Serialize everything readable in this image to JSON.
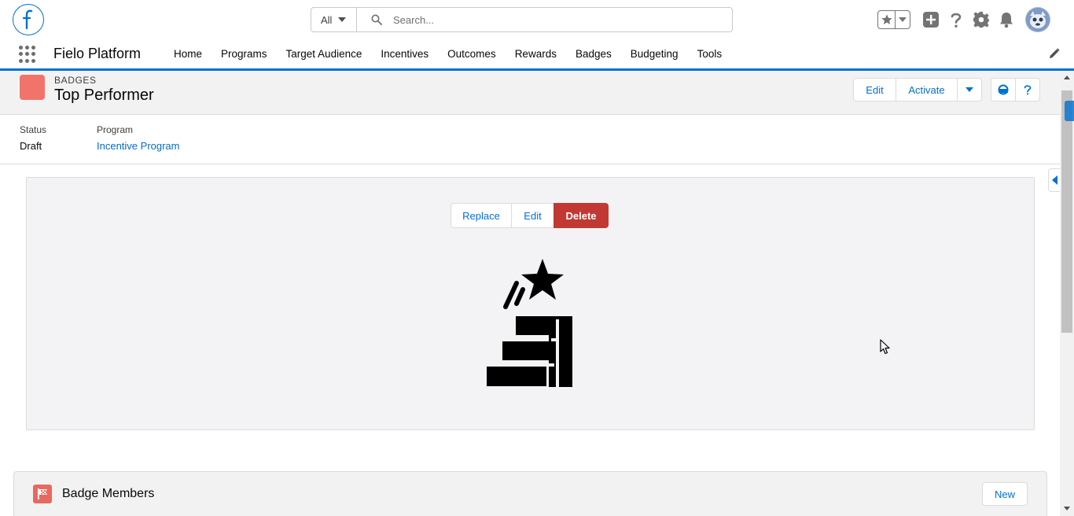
{
  "header": {
    "search_scope": "All",
    "search_placeholder": "Search..."
  },
  "app": {
    "name": "Fielo Platform",
    "nav_items": [
      "Home",
      "Programs",
      "Target Audience",
      "Incentives",
      "Outcomes",
      "Rewards",
      "Badges",
      "Budgeting",
      "Tools"
    ]
  },
  "record": {
    "type_label": "BADGES",
    "title": "Top Performer",
    "actions": {
      "edit": "Edit",
      "activate": "Activate"
    },
    "icon_color": "#f2736a"
  },
  "highlights": {
    "status_label": "Status",
    "status_value": "Draft",
    "program_label": "Program",
    "program_value": "Incentive Program"
  },
  "image_panel": {
    "replace": "Replace",
    "edit": "Edit",
    "delete": "Delete",
    "image_icon": "trophy-podium-star-icon"
  },
  "related": {
    "title": "Badge Members",
    "new_label": "New"
  },
  "colors": {
    "brand": "#0070d2",
    "danger": "#c23934",
    "link": "#006dcc"
  }
}
